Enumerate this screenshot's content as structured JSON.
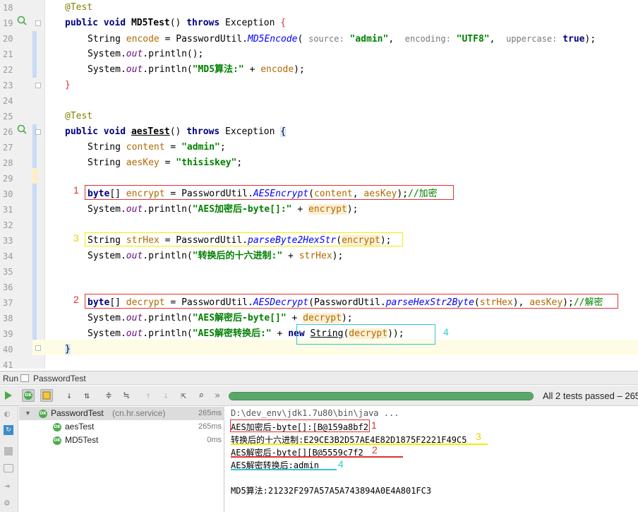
{
  "editor": {
    "lines": [
      {
        "n": "18"
      },
      {
        "n": "19"
      },
      {
        "n": "20"
      },
      {
        "n": "21"
      },
      {
        "n": "22"
      },
      {
        "n": "23"
      },
      {
        "n": "24"
      },
      {
        "n": "25"
      },
      {
        "n": "26"
      },
      {
        "n": "27"
      },
      {
        "n": "28"
      },
      {
        "n": "29"
      },
      {
        "n": "30"
      },
      {
        "n": "31"
      },
      {
        "n": "32"
      },
      {
        "n": "33"
      },
      {
        "n": "34"
      },
      {
        "n": "35"
      },
      {
        "n": "36"
      },
      {
        "n": "37"
      },
      {
        "n": "38"
      },
      {
        "n": "39"
      },
      {
        "n": "40"
      },
      {
        "n": "41"
      }
    ],
    "code": {
      "l18_ann": "@Test",
      "l19_public": "public",
      "l19_void": "void",
      "l19_name": "MD5Test",
      "l19_paren": "()",
      "l19_throws": "throws",
      "l19_exc": "Exception",
      "l19_brace": "{",
      "l20_type": "String",
      "l20_var": "encode",
      "l20_eq": "=",
      "l20_cls": "PasswordUtil.",
      "l20_meth": "MD5Encode",
      "l20_open": "(",
      "l20_h1": "source:",
      "l20_v1": "\"admin\"",
      "l20_h2": "encoding:",
      "l20_v2": "\"UTF8\"",
      "l20_h3": "uppercase:",
      "l20_v3": "true",
      "l20_close": ");",
      "l21_sys": "System.",
      "l21_out": "out",
      "l21_rest": ".println();",
      "l22_sys": "System.",
      "l22_out": "out",
      "l22_pr": ".println(",
      "l22_str": "\"MD5算法:\"",
      "l22_plus": "+",
      "l22_var": "encode",
      "l22_close": ");",
      "l23_brace": "}",
      "l25_ann": "@Test",
      "l26_public": "public",
      "l26_void": "void",
      "l26_name": "aesTest",
      "l26_paren": "()",
      "l26_throws": "throws",
      "l26_exc": "Exception",
      "l26_brace": "{",
      "l27_type": "String",
      "l27_var": "content",
      "l27_eq": "=",
      "l27_str": "\"admin\"",
      "l27_semi": ";",
      "l28_type": "String",
      "l28_var": "aesKey",
      "l28_eq": "=",
      "l28_str": "\"thisiskey\"",
      "l28_semi": ";",
      "l30_type": "byte",
      "l30_arr": "[]",
      "l30_var": "encrypt",
      "l30_eq": "=",
      "l30_cls": "PasswordUtil.",
      "l30_meth": "AESEncrypt",
      "l30_open": "(",
      "l30_a1": "content",
      "l30_comma": ",",
      "l30_a2": "aesKey",
      "l30_close": ");",
      "l30_cmt": "//加密",
      "l31_sys": "System.",
      "l31_out": "out",
      "l31_pr": ".println(",
      "l31_str": "\"AES加密后-byte[]:\"",
      "l31_plus": "+",
      "l31_var": "encrypt",
      "l31_close": ");",
      "l33_type": "String",
      "l33_var": "strHex",
      "l33_eq": "=",
      "l33_cls": "PasswordUtil.",
      "l33_meth": "parseByte2HexStr",
      "l33_open": "(",
      "l33_a1": "encrypt",
      "l33_close": ");",
      "l34_sys": "System.",
      "l34_out": "out",
      "l34_pr": ".println(",
      "l34_str": "\"转换后的十六进制:\"",
      "l34_plus": "+",
      "l34_var": "strHex",
      "l34_close": ");",
      "l37_type": "byte",
      "l37_arr": "[]",
      "l37_var": "decrypt",
      "l37_eq": "=",
      "l37_cls": "PasswordUtil.",
      "l37_meth": "AESDecrypt",
      "l37_open": "(",
      "l37_cls2": "PasswordUtil.",
      "l37_meth2": "parseHexStr2Byte",
      "l37_open2": "(",
      "l37_a1": "strHex",
      "l37_close1": "),",
      "l37_a2": "aesKey",
      "l37_close": ");",
      "l37_cmt": "//解密",
      "l38_sys": "System.",
      "l38_out": "out",
      "l38_pr": ".println(",
      "l38_str": "\"AES解密后-byte[]\"",
      "l38_plus": "+",
      "l38_var": "decrypt",
      "l38_close": ");",
      "l39_sys": "System.",
      "l39_out": "out",
      "l39_pr": ".println(",
      "l39_str": "\"AES解密转换后:\"",
      "l39_plus": "+",
      "l39_new": "new",
      "l39_cls": "String",
      "l39_open": "(",
      "l39_var": "decrypt",
      "l39_close": "));",
      "l40_brace": "}"
    },
    "annotations": {
      "a1": "1",
      "a2": "2",
      "a3": "3",
      "a4": "4"
    }
  },
  "run": {
    "tab_label": "Run",
    "config_name": "PasswordTest",
    "status": "All 2 tests passed – 265",
    "progress": 1.0,
    "tree": {
      "root_label": "PasswordTest",
      "root_pkg": "(cn.hr.service)",
      "root_time": "265ms",
      "children": [
        {
          "label": "aesTest",
          "time": "265ms"
        },
        {
          "label": "MD5Test",
          "time": "0ms"
        }
      ]
    },
    "console": {
      "cmd": "D:\\dev_env\\jdk1.7u80\\bin\\java ...",
      "line1": "AES加密后-byte[]:[B@159a8bf2",
      "line2": "转换后的十六进制:E29CE3B2D57AE4E82D1875F2221F49C5",
      "line3": "AES解密后-byte[][B@5559c7f2",
      "line4": "AES解密转换后:admin",
      "line5": "MD5算法:21232F297A57A5A743894A0E4A801FC3",
      "mark1": "1",
      "mark2": "2",
      "mark3": "3",
      "mark4": "4"
    },
    "ok_badge": "OK"
  },
  "colors": {
    "keyword": "#000080",
    "string": "#008000",
    "static_method": "#0000ff",
    "field": "#660e7a",
    "annotation": "#808000",
    "red_box": "#e03030",
    "yellow_box": "#f0f000",
    "cyan_box": "#30c8d0",
    "progress": "#59a869"
  }
}
